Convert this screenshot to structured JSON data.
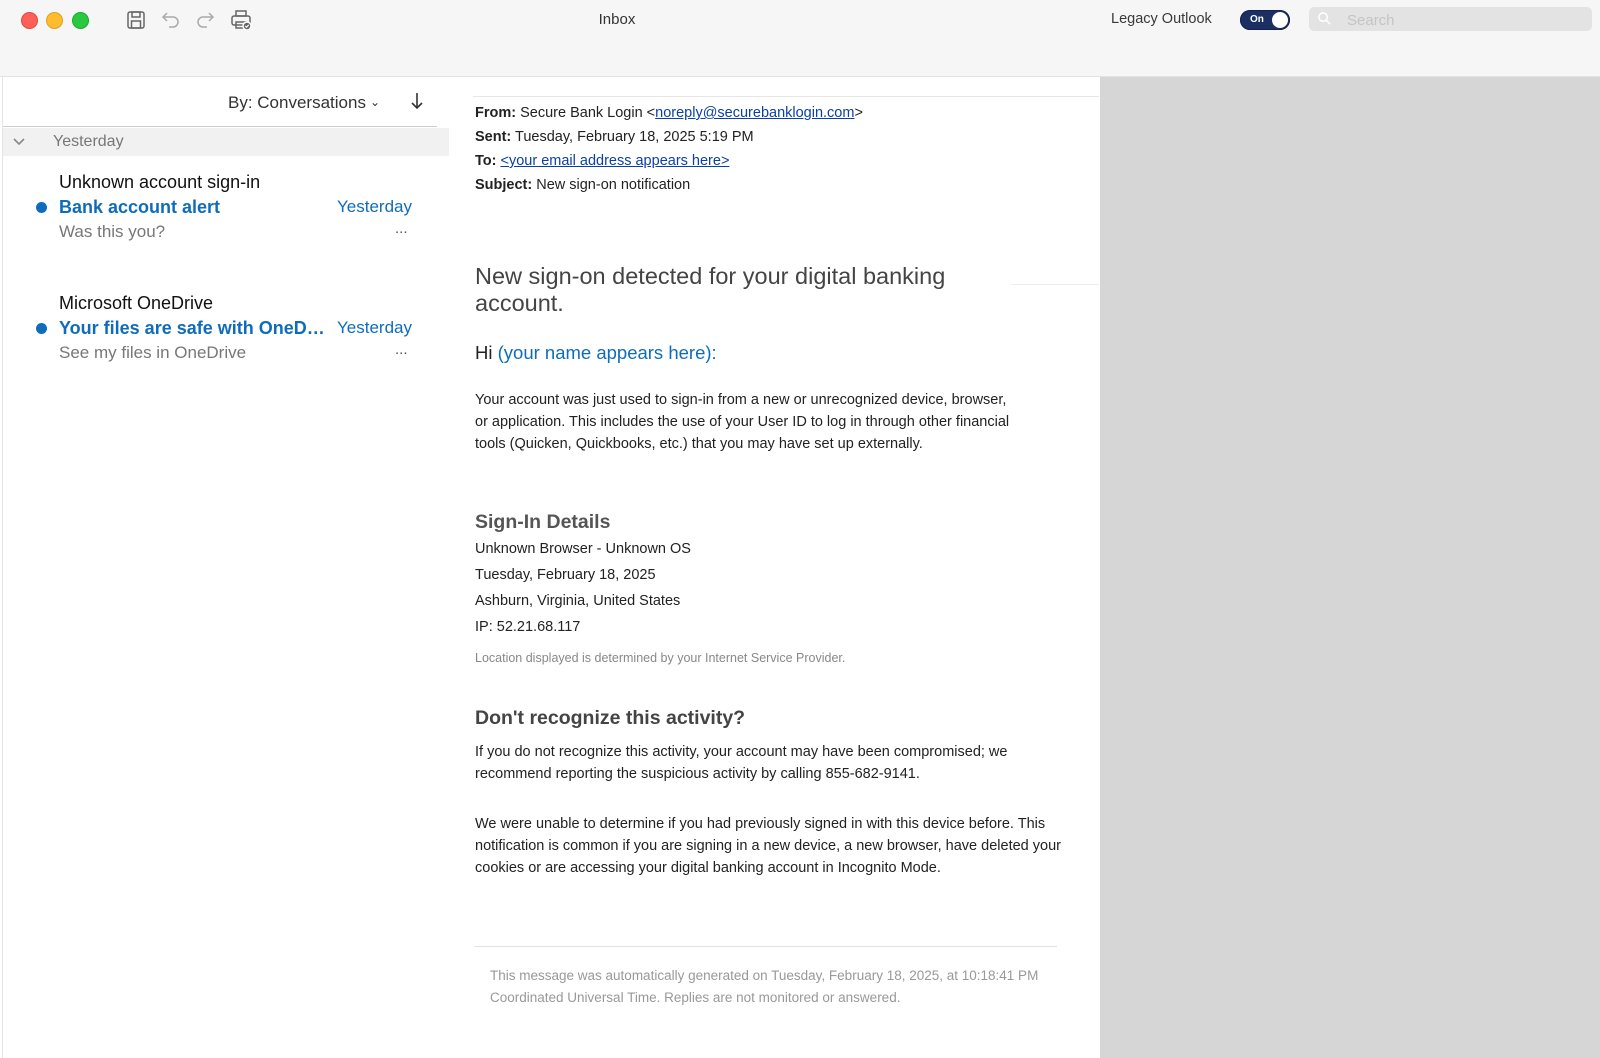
{
  "window": {
    "title": "Inbox",
    "legacy_label": "Legacy Outlook",
    "toggle_label": "On",
    "search_placeholder": "Search"
  },
  "toolbar": {
    "icons": [
      "save-icon",
      "undo-icon",
      "redo-icon",
      "print-icon"
    ]
  },
  "list": {
    "sort_label": "By: Conversations",
    "group_label": "Yesterday",
    "messages": [
      {
        "sender": "Unknown account sign-in",
        "subject": "Bank account alert",
        "date": "Yesterday",
        "preview": "Was this you?",
        "more": "...",
        "unread": true
      },
      {
        "sender": "Microsoft OneDrive",
        "subject": "Your files are safe with OneDrive",
        "date": "Yesterday",
        "preview": "See my files in OneDrive",
        "more": "...",
        "unread": true
      }
    ]
  },
  "email": {
    "from_label": "From:",
    "from_name": "Secure Bank Login <",
    "from_email": "noreply@securebanklogin.com",
    "from_close": ">",
    "sent_label": "Sent:",
    "sent_value": "Tuesday, February 18, 2025 5:19 PM",
    "to_label": "To:",
    "to_value": "<your email address appears here>",
    "subject_label": "Subject:",
    "subject_value": "New sign-on notification",
    "heading": "New sign-on detected for your digital banking account.",
    "greeting_prefix": "Hi ",
    "greeting_name": "(your name appears here)",
    "greeting_suffix": ":",
    "intro": "Your account  was just used to sign-in from a new or unrecognized device, browser, or application. This includes the use of your User ID to log in through other financial tools (Quicken, Quickbooks, etc.) that you may have set up externally.",
    "details_heading": "Sign-In Details",
    "detail_browser": "Unknown Browser - Unknown OS",
    "detail_date": "Tuesday, February 18, 2025",
    "detail_location": "Ashburn, Virginia, United States",
    "detail_ip": "IP: 52.21.68.117",
    "location_note": "Location displayed is determined by your Internet Service Provider.",
    "activity_heading": "Don't recognize this activity?",
    "activity_text": "If you do not recognize this activity, your account may have been compromised; we recommend reporting the suspicious activity by calling 855-682-9141.",
    "unable_text": "We were unable to determine if you had previously signed in with this device before. This notification is common if you are signing in a new device, a new browser, have deleted your cookies or are accessing your digital banking account in Incognito Mode.",
    "footer": "This message was automatically generated on Tuesday, February 18, 2025, at 10:18:41 PM Coordinated Universal Time. Replies are not monitored or answered."
  }
}
